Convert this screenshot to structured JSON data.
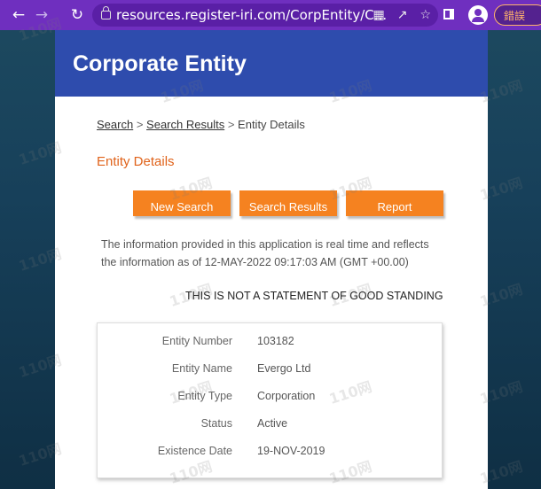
{
  "browser": {
    "url": "resources.register-iri.com/CorpEntity/C...",
    "error_badge": "錯誤",
    "icons": [
      "back-icon",
      "forward-icon",
      "reload-icon",
      "lock-icon",
      "translate-icon",
      "share-icon",
      "star-icon",
      "sidepanel-icon",
      "profile-icon"
    ]
  },
  "header": {
    "title": "Corporate Entity"
  },
  "breadcrumb": {
    "search": "Search",
    "sep1": ">",
    "results": "Search Results",
    "sep2": ">",
    "current": "Entity Details"
  },
  "section_title": "Entity Details",
  "buttons": {
    "new_search": "New Search",
    "search_results": "Search Results",
    "report": "Report"
  },
  "info": {
    "line1": "The information provided in this application is real time and reflects",
    "line2": "the information as of 12-MAY-2022 09:17:03 AM (GMT +00.00)"
  },
  "notice": "THIS IS NOT A STATEMENT OF GOOD STANDING",
  "entity": [
    {
      "label": "Entity Number",
      "value": "103182"
    },
    {
      "label": "Entity Name",
      "value": "Evergo Ltd"
    },
    {
      "label": "Entity Type",
      "value": "Corporation"
    },
    {
      "label": "Status",
      "value": "Active"
    },
    {
      "label": "Existence Date",
      "value": "19-NOV-2019"
    }
  ],
  "watermark": "110网",
  "colors": {
    "toolbar": "#6f2fbf",
    "header": "#2e4cad",
    "accent": "#f58220",
    "title": "#e0631b"
  }
}
